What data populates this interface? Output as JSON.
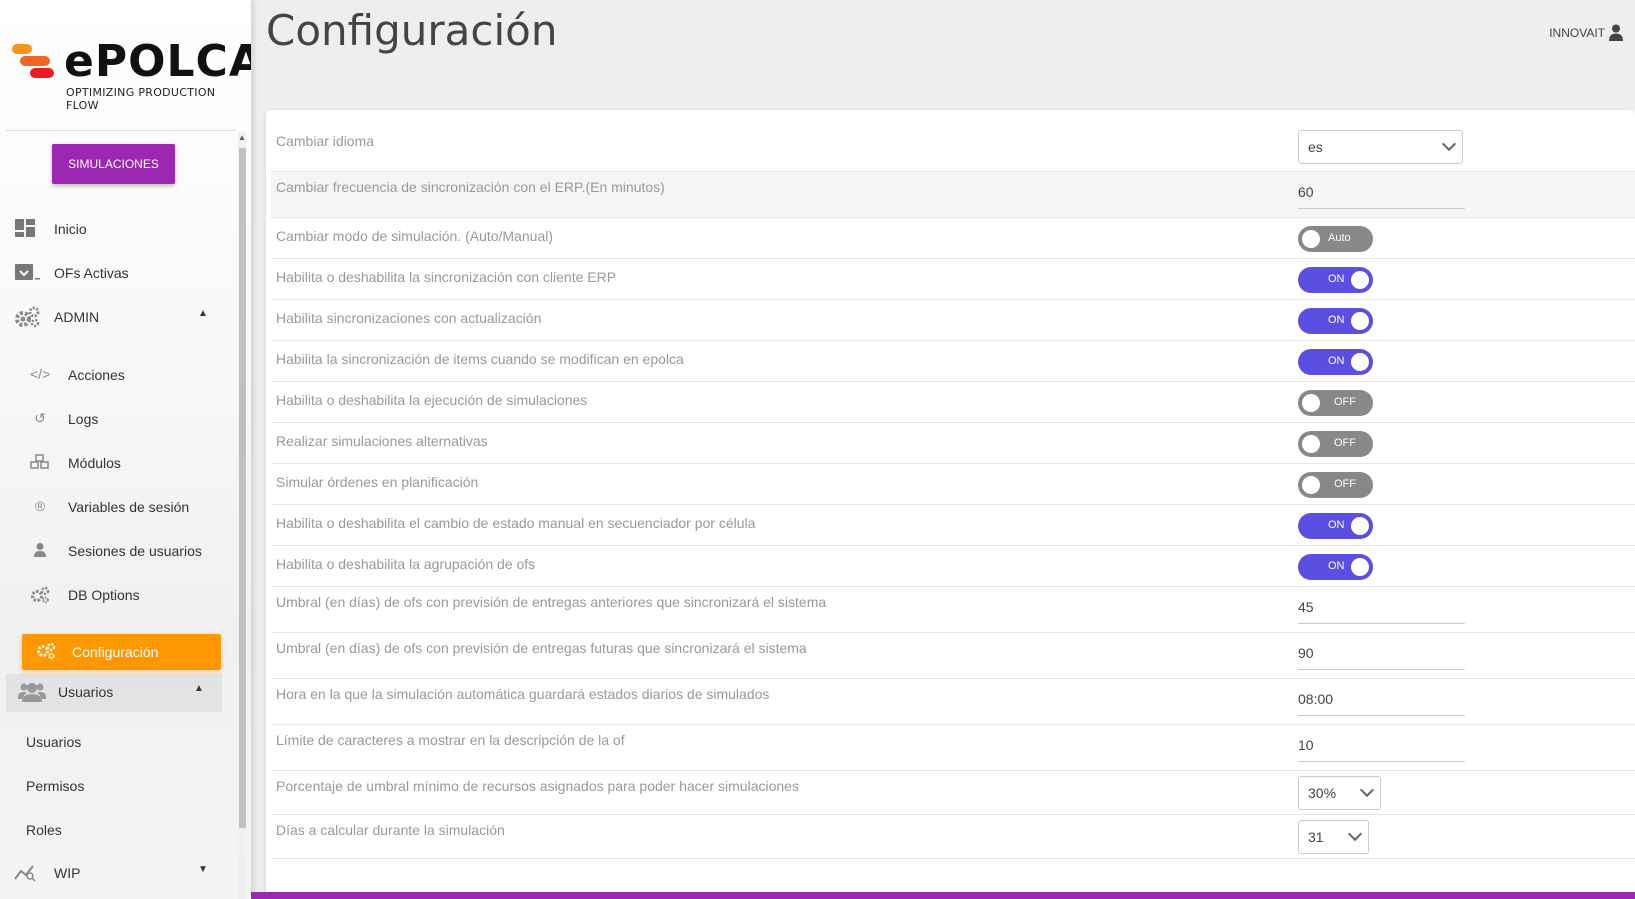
{
  "brand": {
    "name": "ePOLCA",
    "tagline": "OPTIMIZING PRODUCTION FLOW",
    "colors": {
      "accent": "#9c27b0",
      "active": "#ff9800",
      "toggle_on": "#5a4fe0",
      "toggle_off": "#888888"
    }
  },
  "sidebar": {
    "sim_button": "SIMULACIONES",
    "nav": [
      {
        "label": "Inicio",
        "icon": "dashboard-icon"
      },
      {
        "label": "OFs Activas",
        "icon": "archive-icon"
      },
      {
        "label": "ADMIN",
        "icon": "gears-icon"
      }
    ],
    "admin_items": [
      {
        "label": "Acciones",
        "icon": "code-icon"
      },
      {
        "label": "Logs",
        "icon": "history-icon"
      },
      {
        "label": "Módulos",
        "icon": "cubes-icon"
      },
      {
        "label": "Variables de sesión",
        "icon": "registered-icon"
      },
      {
        "label": "Sesiones de usuarios",
        "icon": "user-icon"
      },
      {
        "label": "DB Options",
        "icon": "gears-icon"
      }
    ],
    "active_item": "Configuración",
    "users_section": "Usuarios",
    "users_items": [
      "Usuarios",
      "Permisos",
      "Roles"
    ],
    "wip": "WIP"
  },
  "header": {
    "title": "Configuración",
    "user": "INNOVAIT"
  },
  "settings": [
    {
      "label": "Cambiar idioma",
      "type": "select",
      "value": "es"
    },
    {
      "label": "Cambiar frecuencia de sincronización con el ERP.(En minutos)",
      "type": "text",
      "value": "60"
    },
    {
      "label": "Cambiar modo de simulación. (Auto/Manual)",
      "type": "toggle",
      "state": "off",
      "value": "Auto"
    },
    {
      "label": "Habilita o deshabilita la sincronización con cliente ERP",
      "type": "toggle",
      "state": "on",
      "value": "ON"
    },
    {
      "label": "Habilita sincronizaciones con actualización",
      "type": "toggle",
      "state": "on",
      "value": "ON"
    },
    {
      "label": "Habilita la sincronización de items cuando se modifican en epolca",
      "type": "toggle",
      "state": "on",
      "value": "ON"
    },
    {
      "label": "Habilita o deshabilita la ejecución de simulaciones",
      "type": "toggle",
      "state": "off",
      "value": "OFF"
    },
    {
      "label": "Realizar simulaciones alternativas",
      "type": "toggle",
      "state": "off",
      "value": "OFF"
    },
    {
      "label": "Simular órdenes en planificación",
      "type": "toggle",
      "state": "off",
      "value": "OFF"
    },
    {
      "label": "Habilita o deshabilita el cambio de estado manual en secuenciador por célula",
      "type": "toggle",
      "state": "on",
      "value": "ON"
    },
    {
      "label": "Habilita o deshabilita la agrupación de ofs",
      "type": "toggle",
      "state": "on",
      "value": "ON"
    },
    {
      "label": "Umbral (en días) de ofs con previsión de entregas anteriores que sincronizará el sistema",
      "type": "text",
      "value": "45"
    },
    {
      "label": "Umbral (en días) de ofs con previsión de entregas futuras que sincronizará el sistema",
      "type": "text",
      "value": "90"
    },
    {
      "label": "Hora en la que la simulación automática guardará estados diarios de simulados",
      "type": "text",
      "value": "08:00"
    },
    {
      "label": "Límite de caracteres a mostrar en la descripción de la of",
      "type": "text",
      "value": "10"
    },
    {
      "label": "Porcentaje de umbral mínimo de recursos asignados para poder hacer simulaciones",
      "type": "select",
      "value": "30%"
    },
    {
      "label": "Días a calcular durante la simulación",
      "type": "select",
      "value": "31"
    }
  ]
}
